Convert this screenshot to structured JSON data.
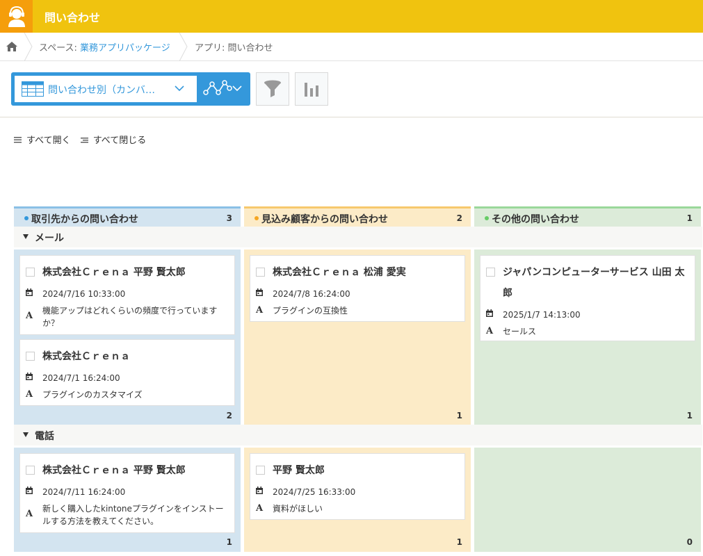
{
  "header": {
    "title": "問い合わせ",
    "icon": "headset-user-icon",
    "bg": "#f0c30f",
    "icon_bg": "#f59e0b"
  },
  "breadcrumb": {
    "space_label": "スペース: ",
    "space_name": "業務アプリパッケージ",
    "app_label": "アプリ: 問い合わせ"
  },
  "toolbar": {
    "view_name": "問い合わせ別（カンバ…",
    "accent": "#3498db"
  },
  "expand": {
    "open_all": "すべて開く",
    "close_all": "すべて閉じる"
  },
  "columns": [
    {
      "name": "取引先からの問い合わせ",
      "count": "3",
      "dot": "#3498db",
      "bar": "#8ac0e6",
      "bg": "#d3e4f0"
    },
    {
      "name": "見込み顧客からの問い合わせ",
      "count": "2",
      "dot": "#f5a623",
      "bar": "#f7c86d",
      "bg": "#fcebc7"
    },
    {
      "name": "その他の問い合わせ",
      "count": "1",
      "dot": "#66cc66",
      "bar": "#9ad89a",
      "bg": "#dcebd9"
    }
  ],
  "groups": [
    {
      "label": "メール",
      "lanes": [
        {
          "count": "2",
          "cards": [
            {
              "title": "株式会社Ｃｒｅｎａ 平野 賢太郎",
              "date": "2024/7/16 10:33:00",
              "text": "機能アップはどれくらいの頻度で行っていますか？"
            },
            {
              "title": "株式会社Ｃｒｅｎａ",
              "date": "2024/7/1 16:24:00",
              "text": "プラグインのカスタマイズ"
            }
          ]
        },
        {
          "count": "1",
          "cards": [
            {
              "title": "株式会社Ｃｒｅｎａ 松浦 愛実",
              "date": "2024/7/8 16:24:00",
              "text": "プラグインの互換性"
            }
          ]
        },
        {
          "count": "1",
          "cards": [
            {
              "title": "ジャパンコンピューターサービス 山田 太郎",
              "date": "2025/1/7 14:13:00",
              "text": "セールス"
            }
          ]
        }
      ]
    },
    {
      "label": "電話",
      "lanes": [
        {
          "count": "1",
          "cards": [
            {
              "title": "株式会社Ｃｒｅｎａ 平野 賢太郎",
              "date": "2024/7/11 16:24:00",
              "text": "新しく購入したkintoneプラグインをインストールする方法を教えてください。"
            }
          ]
        },
        {
          "count": "1",
          "cards": [
            {
              "title": "平野 賢太郎",
              "date": "2024/7/25 16:33:00",
              "text": "資料がほしい"
            }
          ]
        },
        {
          "count": "0",
          "cards": []
        }
      ]
    }
  ]
}
